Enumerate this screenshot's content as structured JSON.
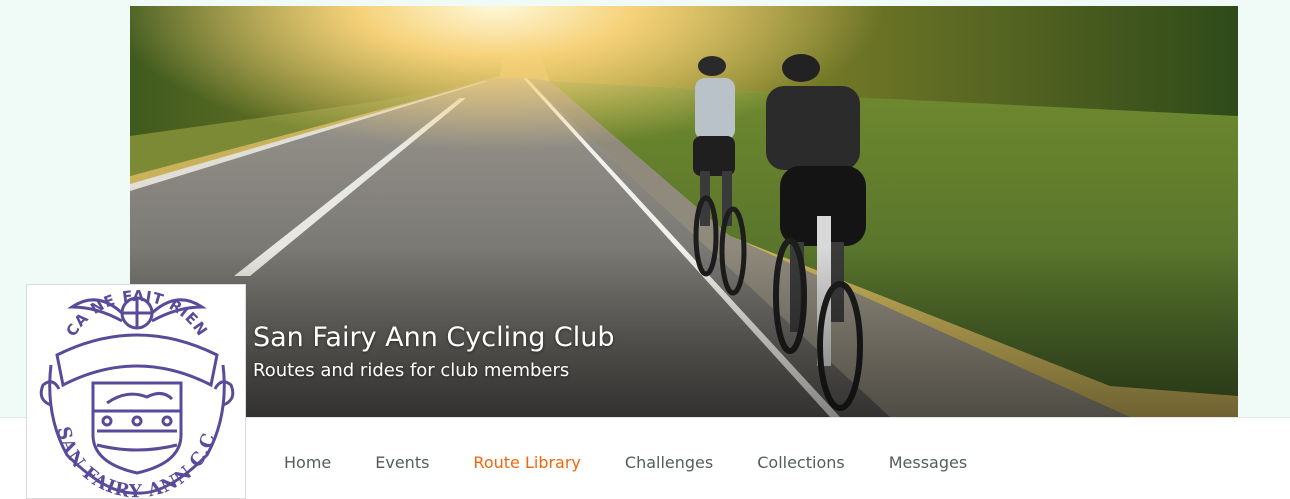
{
  "club": {
    "name": "San Fairy Ann Cycling Club",
    "tagline": "Routes and rides for club members"
  },
  "logo": {
    "top_text": "CA NE FAIT RIEN",
    "bottom_text": "SAN FAIRY ANN C.C.",
    "color": "#5a4a9a"
  },
  "banner": {
    "description_icon": "cyclists-road-photo"
  },
  "nav": {
    "items": [
      {
        "label": "Home",
        "active": false
      },
      {
        "label": "Events",
        "active": false
      },
      {
        "label": "Route Library",
        "active": true
      },
      {
        "label": "Challenges",
        "active": false
      },
      {
        "label": "Collections",
        "active": false
      },
      {
        "label": "Messages",
        "active": false
      }
    ]
  },
  "colors": {
    "accent": "#f2660a",
    "nav_text": "#555b60",
    "page_background": "#f0faf6"
  }
}
